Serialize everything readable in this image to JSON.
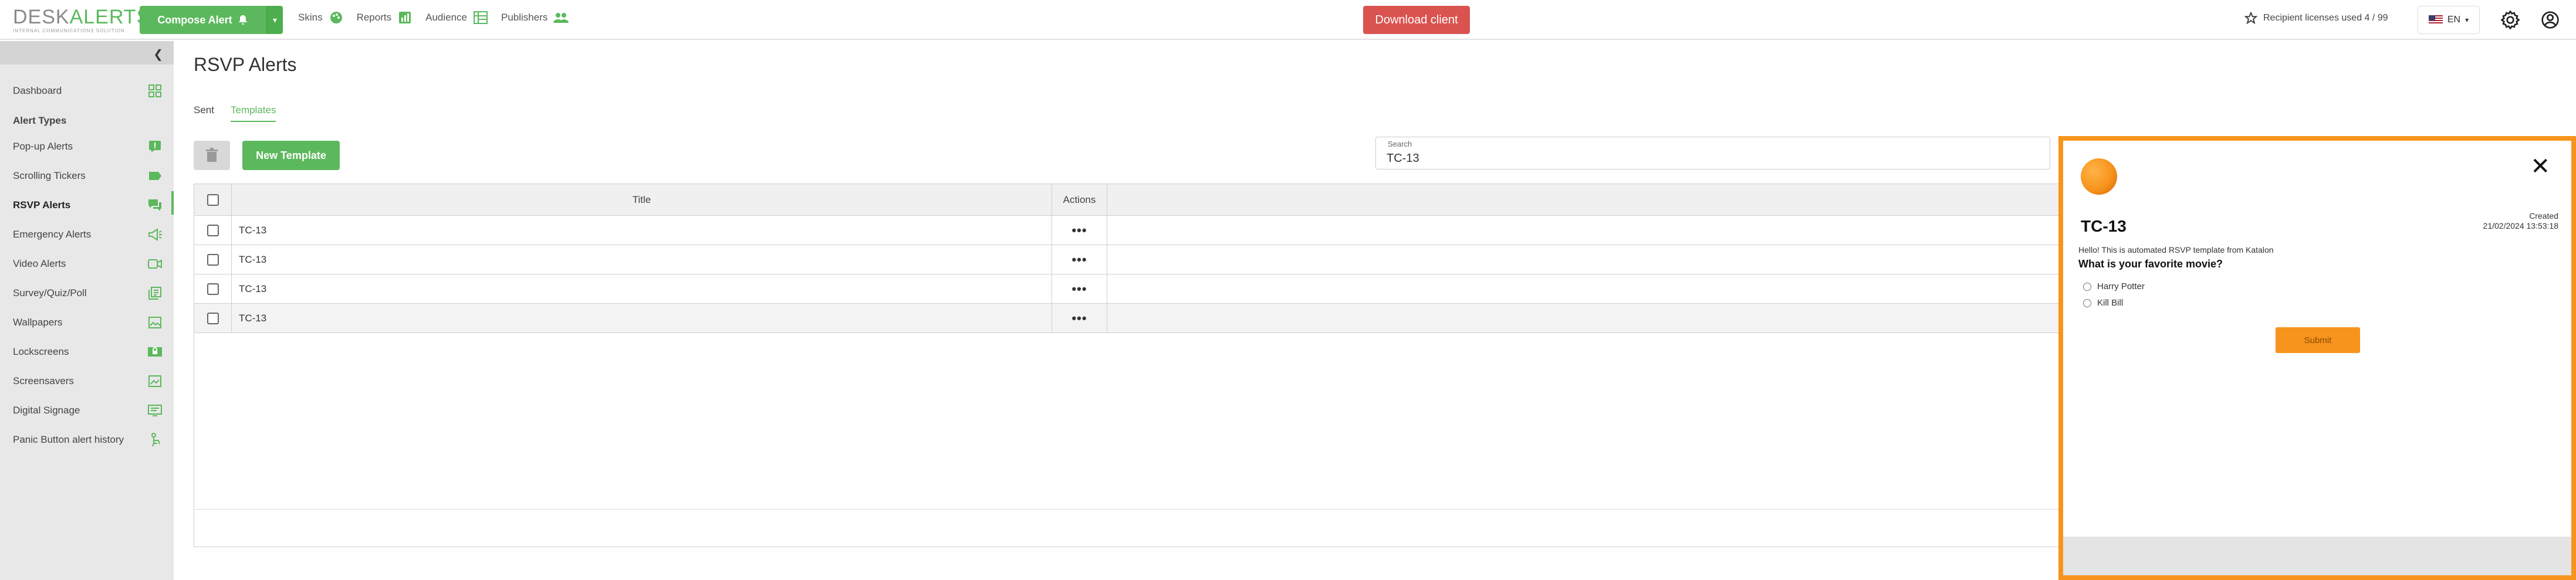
{
  "app": {
    "logo_brand_part1": "DESK",
    "logo_brand_part2": "ALERTS",
    "logo_tagline": "INTERNAL COMMUNICATIONS SOLUTION"
  },
  "topbar": {
    "compose_label": "Compose Alert",
    "nav": [
      {
        "label": "Skins",
        "icon": "palette-icon"
      },
      {
        "label": "Reports",
        "icon": "chart-icon"
      },
      {
        "label": "Audience",
        "icon": "org-chart-icon"
      },
      {
        "label": "Publishers",
        "icon": "people-icon"
      }
    ],
    "download_label": "Download client",
    "licenses_label": "Recipient licenses used 4 / 99",
    "language": "EN"
  },
  "sidebar": {
    "dashboard": "Dashboard",
    "section_title": "Alert Types",
    "items": [
      {
        "label": "Pop-up Alerts",
        "icon": "popup-icon"
      },
      {
        "label": "Scrolling Tickers",
        "icon": "ticker-icon"
      },
      {
        "label": "RSVP Alerts",
        "icon": "chat-icon",
        "active": true
      },
      {
        "label": "Emergency Alerts",
        "icon": "megaphone-icon"
      },
      {
        "label": "Video Alerts",
        "icon": "video-icon"
      },
      {
        "label": "Survey/Quiz/Poll",
        "icon": "survey-icon"
      },
      {
        "label": "Wallpapers",
        "icon": "wallpaper-icon"
      },
      {
        "label": "Lockscreens",
        "icon": "lockscreen-icon"
      },
      {
        "label": "Screensavers",
        "icon": "screensaver-icon"
      },
      {
        "label": "Digital Signage",
        "icon": "signage-icon"
      },
      {
        "label": "Panic Button alert history",
        "icon": "panic-icon"
      }
    ]
  },
  "main": {
    "page_title": "RSVP Alerts",
    "tabs": [
      {
        "label": "Sent",
        "active": false
      },
      {
        "label": "Templates",
        "active": true
      }
    ],
    "new_template_label": "New Template",
    "search_label": "Search",
    "search_value": "TC-13",
    "table": {
      "headers": {
        "title": "Title",
        "actions": "Actions"
      },
      "rows": [
        {
          "title": "TC-13",
          "actions": "•••"
        },
        {
          "title": "TC-13",
          "actions": "•••"
        },
        {
          "title": "TC-13",
          "actions": "•••"
        },
        {
          "title": "TC-13",
          "actions": "•••"
        }
      ]
    }
  },
  "preview": {
    "close_glyph": "✕",
    "title": "TC-13",
    "created_label": "Created",
    "created_value": "21/02/2024 13:53:18",
    "body": "Hello! This is automated RSVP template from Katalon",
    "question": "What is your favorite movie?",
    "options": [
      "Harry Potter",
      "Kill Bill"
    ],
    "submit_label": "Submit"
  },
  "colors": {
    "accent_green": "#5cb85c",
    "danger_red": "#d9534f",
    "preview_orange": "#f7941d"
  }
}
